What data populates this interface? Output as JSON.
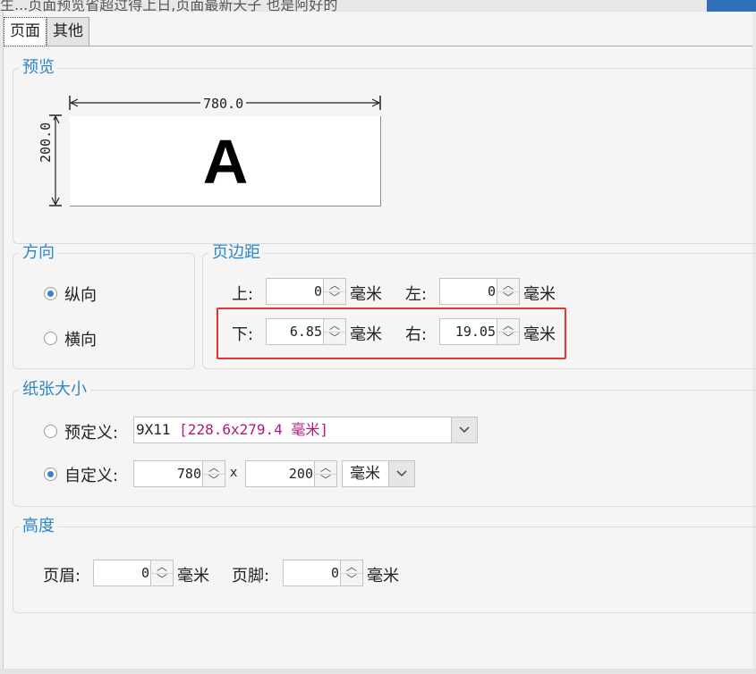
{
  "background": {
    "partial_text": "生...页面预览省超过得上日,页面最新天子 也是阿好的"
  },
  "tabs": [
    {
      "label": "页面",
      "active": true
    },
    {
      "label": "其他",
      "active": false
    }
  ],
  "preview": {
    "legend": "预览",
    "width_label": "780.0",
    "height_label": "200.0",
    "sample_glyph": "A"
  },
  "orientation": {
    "legend": "方向",
    "portrait_label": "纵向",
    "landscape_label": "横向",
    "selected": "portrait"
  },
  "margins": {
    "legend": "页边距",
    "top_label": "上:",
    "top_value": "0",
    "left_label": "左:",
    "left_value": "0",
    "bottom_label": "下:",
    "bottom_value": "6.85",
    "right_label": "右:",
    "right_value": "19.05",
    "unit": "毫米"
  },
  "paper_size": {
    "legend": "纸张大小",
    "predefined_label": "预定义:",
    "predefined_value_prefix": "9X11 ",
    "predefined_value_detail": "[228.6x279.4 毫米]",
    "custom_label": "自定义:",
    "custom_width": "780",
    "times_sign": "x",
    "custom_height": "200",
    "unit_selected": "毫米",
    "selected": "custom",
    "accent_color_detail": "#b0187e"
  },
  "height": {
    "legend": "高度",
    "header_label": "页眉:",
    "header_value": "0",
    "footer_label": "页脚:",
    "footer_value": "0",
    "unit": "毫米"
  },
  "colors": {
    "legend_blue": "#2c86c8",
    "highlight_red": "#e33535",
    "radio_selected": "#3a7fd6"
  }
}
